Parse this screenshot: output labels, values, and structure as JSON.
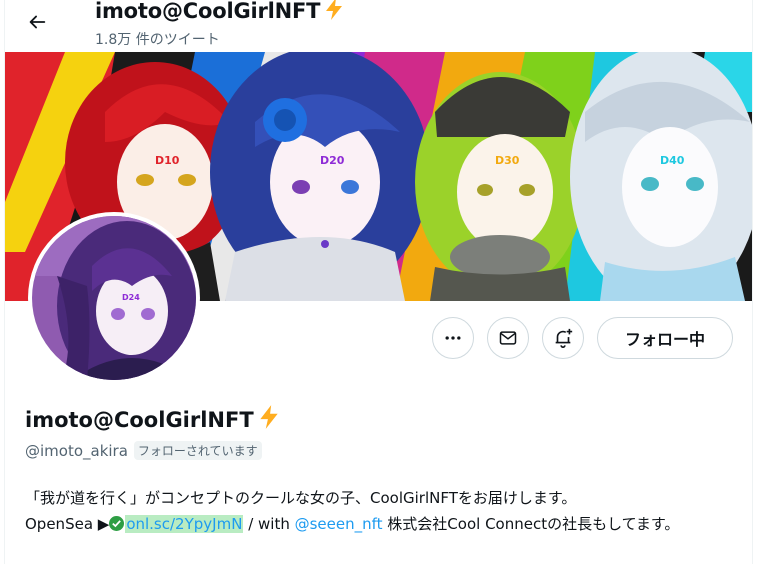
{
  "header": {
    "back_label": "←",
    "name": "imoto@CoolGirlNFT",
    "tweet_count": "1.8万 件のツイート"
  },
  "profile": {
    "display_name": "imoto@CoolGirlNFT",
    "handle": "@imoto_akira",
    "follows_you_badge": "フォローされています",
    "follow_button_label": "フォロー中",
    "bio": {
      "line1": "「我が道を行く」がコンセプトのクールな女の子、CoolGirlNFTをお届けします。",
      "opensea_prefix": "OpenSea ▶",
      "opensea_link": "onl.sc/2YpyJmN",
      "with_text": " / with ",
      "mention_link": "@seeen_nft",
      "tail_text": " 株式会社Cool Connectの社長もしてます。"
    }
  },
  "banner": {
    "character_tags": [
      "D10",
      "D20",
      "D30",
      "D40"
    ],
    "avatar_tag": "D24"
  },
  "colors": {
    "accent": "#1d9bf0",
    "text_primary": "#0f1419",
    "text_secondary": "#536471",
    "border": "#cfd9de",
    "bolt": "#ffad1f",
    "link_highlight": "#b9ecc2"
  },
  "icons": [
    "arrow-left-icon",
    "lightning-bolt-emoji",
    "more-dots-icon",
    "mail-icon",
    "bell-plus-icon",
    "check-circle-emoji"
  ]
}
